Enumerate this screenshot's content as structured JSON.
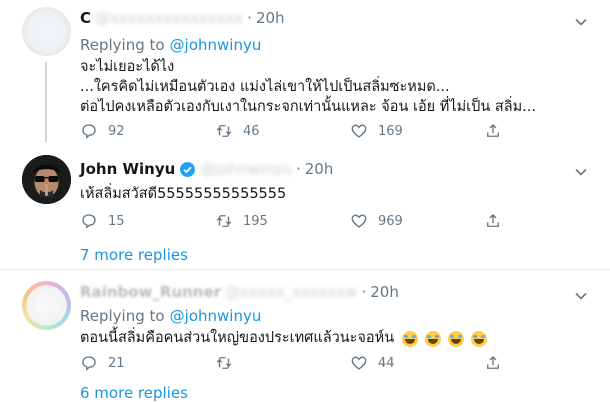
{
  "tweets": [
    {
      "name": "C",
      "handle_blurred": "@xxxxxxxxxxxxxxx",
      "sep": "·",
      "time": "20h",
      "reply_label": "Replying to",
      "reply_to": "@johnwinyu",
      "lines": [
        "จะไม่เยอะได้ไง",
        "...ใครคิดไม่เหมือนตัวเอง แม่งไล่เขาให้ไปเป็นสลิ่มซะหมด...",
        "ต่อไปคงเหลือตัวเองกับเงาในกระจกเท่านั้นแหละ จ้อน เอ้ย ที่ไม่เป็น สลิ่ม..."
      ],
      "actions": {
        "reply": "92",
        "retweet": "46",
        "like": "169"
      }
    },
    {
      "name": "John Winyu",
      "handle_blurred": "@johnwinyu",
      "sep": "·",
      "time": "20h",
      "lines": [
        "เห้สลิ่มสวัสดี55555555555555"
      ],
      "actions": {
        "reply": "15",
        "retweet": "195",
        "like": "969"
      }
    },
    {
      "name": "Rainbow_Runner",
      "handle_blurred": "@xxxxx_xxxxxxw",
      "sep": "·",
      "time": "20h",
      "reply_label": "Replying to",
      "reply_to": "@johnwinyu",
      "lines": [
        "ตอนนี้สลิ่มคือคนส่วนใหญ่ของประเทศแล้วนะจอห์น"
      ],
      "emoji_count": 4,
      "actions": {
        "reply": "21",
        "retweet": "",
        "like": "44"
      }
    }
  ],
  "more_replies": [
    "7 more replies",
    "6 more replies"
  ],
  "icons": [
    "reply-icon",
    "retweet-icon",
    "like-icon",
    "share-icon",
    "chevron-down-icon",
    "verified-badge-icon"
  ],
  "colors": {
    "link": "#1b95e0",
    "muted": "#657786",
    "divider": "#e6ecf0"
  }
}
